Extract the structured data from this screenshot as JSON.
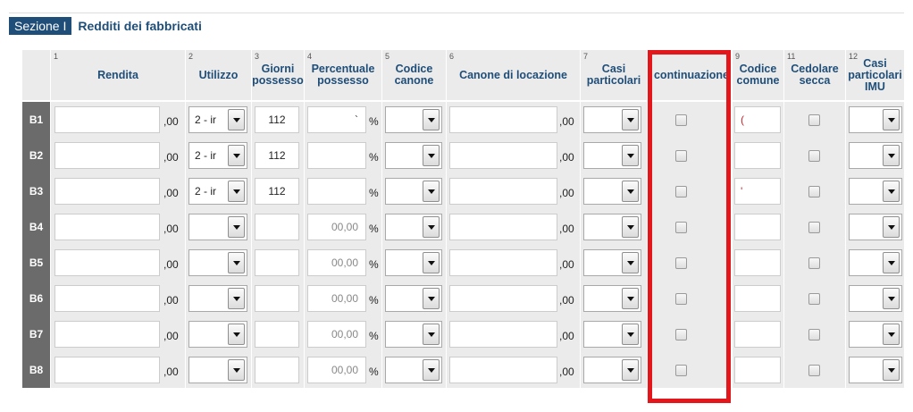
{
  "section": {
    "badge": "Sezione I",
    "title": "Redditi dei fabbricati"
  },
  "columns": [
    {
      "num": "1",
      "label": "Rendita"
    },
    {
      "num": "2",
      "label": "Utilizzo"
    },
    {
      "num": "3",
      "label": "Giorni possesso"
    },
    {
      "num": "4",
      "label": "Percentuale possesso"
    },
    {
      "num": "5",
      "label": "Codice canone"
    },
    {
      "num": "6",
      "label": "Canone di locazione"
    },
    {
      "num": "7",
      "label": "Casi particolari"
    },
    {
      "num": "",
      "label": "continuazione"
    },
    {
      "num": "9",
      "label": "Codice comune"
    },
    {
      "num": "11",
      "label": "Cedolare secca"
    },
    {
      "num": "12",
      "label": "Casi particolari IMU"
    }
  ],
  "decimal_suffix": ",00",
  "percent_sign": "%",
  "rows": [
    {
      "label": "B1",
      "utilizzo": "2 - ir",
      "giorni": "112",
      "percentuale": "`",
      "codice_comune": "("
    },
    {
      "label": "B2",
      "utilizzo": "2 - ir",
      "giorni": "112",
      "percentuale": "",
      "codice_comune": ""
    },
    {
      "label": "B3",
      "utilizzo": "2 - ir",
      "giorni": "112",
      "percentuale": "",
      "codice_comune": "'"
    },
    {
      "label": "B4",
      "utilizzo": "",
      "giorni": "",
      "percentuale": "00,00",
      "codice_comune": ""
    },
    {
      "label": "B5",
      "utilizzo": "",
      "giorni": "",
      "percentuale": "00,00",
      "codice_comune": ""
    },
    {
      "label": "B6",
      "utilizzo": "",
      "giorni": "",
      "percentuale": "00,00",
      "codice_comune": ""
    },
    {
      "label": "B7",
      "utilizzo": "",
      "giorni": "",
      "percentuale": "00,00",
      "codice_comune": ""
    },
    {
      "label": "B8",
      "utilizzo": "",
      "giorni": "",
      "percentuale": "00,00",
      "codice_comune": ""
    }
  ],
  "colors": {
    "header_blue": "#1f4e79",
    "row_label_gray": "#6b6b6b",
    "cell_gray": "#ebebeb",
    "highlight_red": "#e3161b"
  },
  "icons": {
    "select_arrow": "chevron-down-icon"
  }
}
